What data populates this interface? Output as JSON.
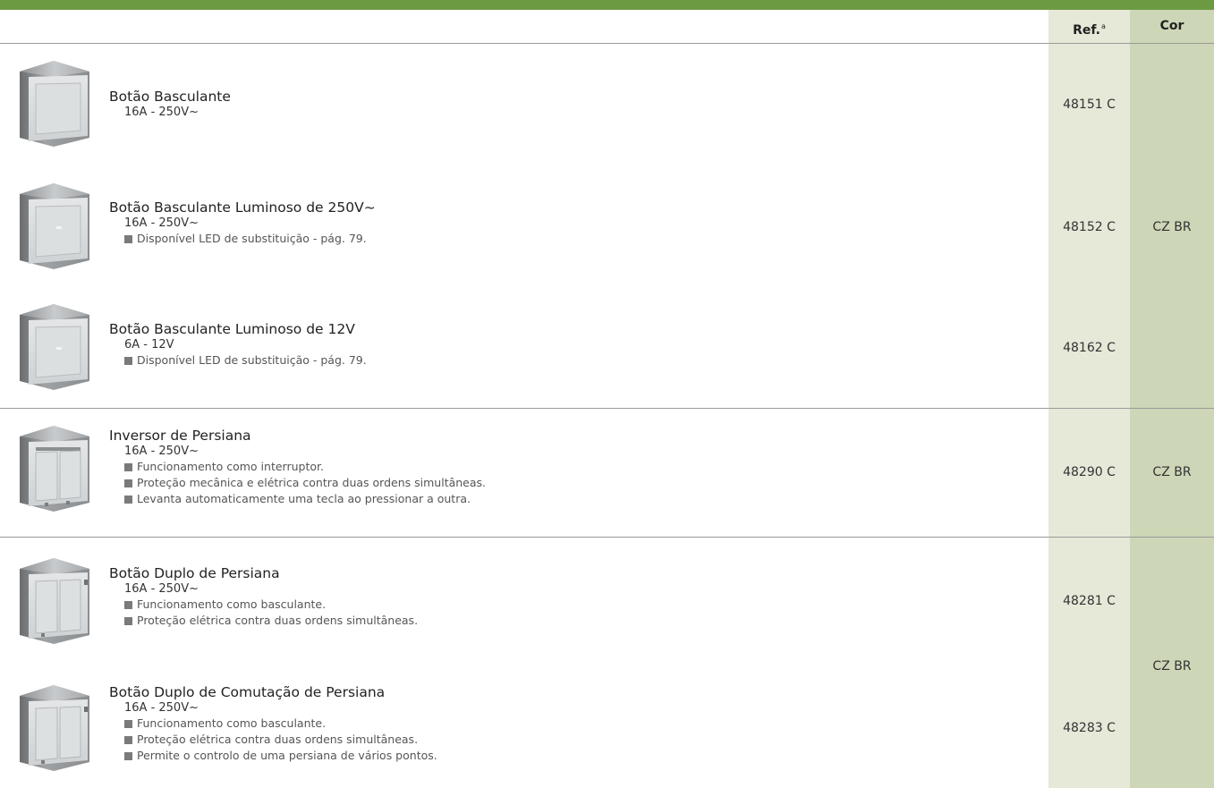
{
  "header": {
    "ref_label": "Ref.",
    "ref_sup": "a",
    "cor_label": "Cor"
  },
  "products": [
    {
      "name": "Botão Basculante",
      "spec": "16A - 250V~",
      "notes": [],
      "ref": "48151 C"
    },
    {
      "name": "Botão Basculante Luminoso de 250V~",
      "spec": "16A - 250V~",
      "notes": [
        "Disponível LED de substituição - pág. 79."
      ],
      "ref": "48152 C"
    },
    {
      "name": "Botão Basculante Luminoso de 12V",
      "spec": "6A - 12V",
      "notes": [
        "Disponível LED de substituição - pág. 79."
      ],
      "ref": "48162 C"
    },
    {
      "name": "Inversor de Persiana",
      "spec": "16A - 250V~",
      "notes": [
        "Funcionamento como interruptor.",
        "Proteção mecânica e elétrica contra duas ordens simultâneas.",
        "Levanta automaticamente uma tecla ao pressionar a outra."
      ],
      "ref": "48290 C"
    },
    {
      "name": "Botão Duplo de Persiana",
      "spec": "16A - 250V~",
      "notes": [
        "Funcionamento como basculante.",
        "Proteção elétrica contra duas ordens simultâneas."
      ],
      "ref": "48281 C"
    },
    {
      "name": "Botão Duplo de Comutação de Persiana",
      "spec": "16A - 250V~",
      "notes": [
        "Funcionamento como basculante.",
        "Proteção elétrica contra duas ordens simultâneas.",
        "Permite o controlo de uma persiana de vários pontos."
      ],
      "ref": "48283 C"
    }
  ],
  "colors": {
    "group1": "CZ BR",
    "group2": "CZ BR",
    "group3": "CZ BR"
  },
  "icons": {
    "p0": "rocker-switch-single-icon",
    "p1": "rocker-switch-single-icon",
    "p2": "rocker-switch-single-icon",
    "p3": "double-rocker-switch-icon",
    "p4": "double-rocker-switch-icon",
    "p5": "double-rocker-switch-icon"
  },
  "palette": {
    "header_bar": "#6b9a43",
    "ref_column": "#e6e8d8",
    "cor_column": "#cdd6b6"
  }
}
